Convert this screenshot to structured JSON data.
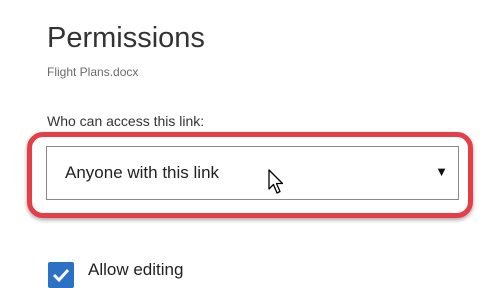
{
  "panel": {
    "title": "Permissions",
    "file_name": "Flight Plans.docx"
  },
  "access": {
    "label": "Who can access this link:",
    "selected": "Anyone with this link"
  },
  "options": {
    "allow_editing_label": "Allow editing",
    "allow_editing_checked": true
  },
  "colors": {
    "highlight": "#e53e46",
    "checkbox": "#2b71c4"
  },
  "icons": {
    "dropdown": "caret-down-icon",
    "pointer": "mouse-cursor-icon",
    "check": "checkmark-icon"
  }
}
